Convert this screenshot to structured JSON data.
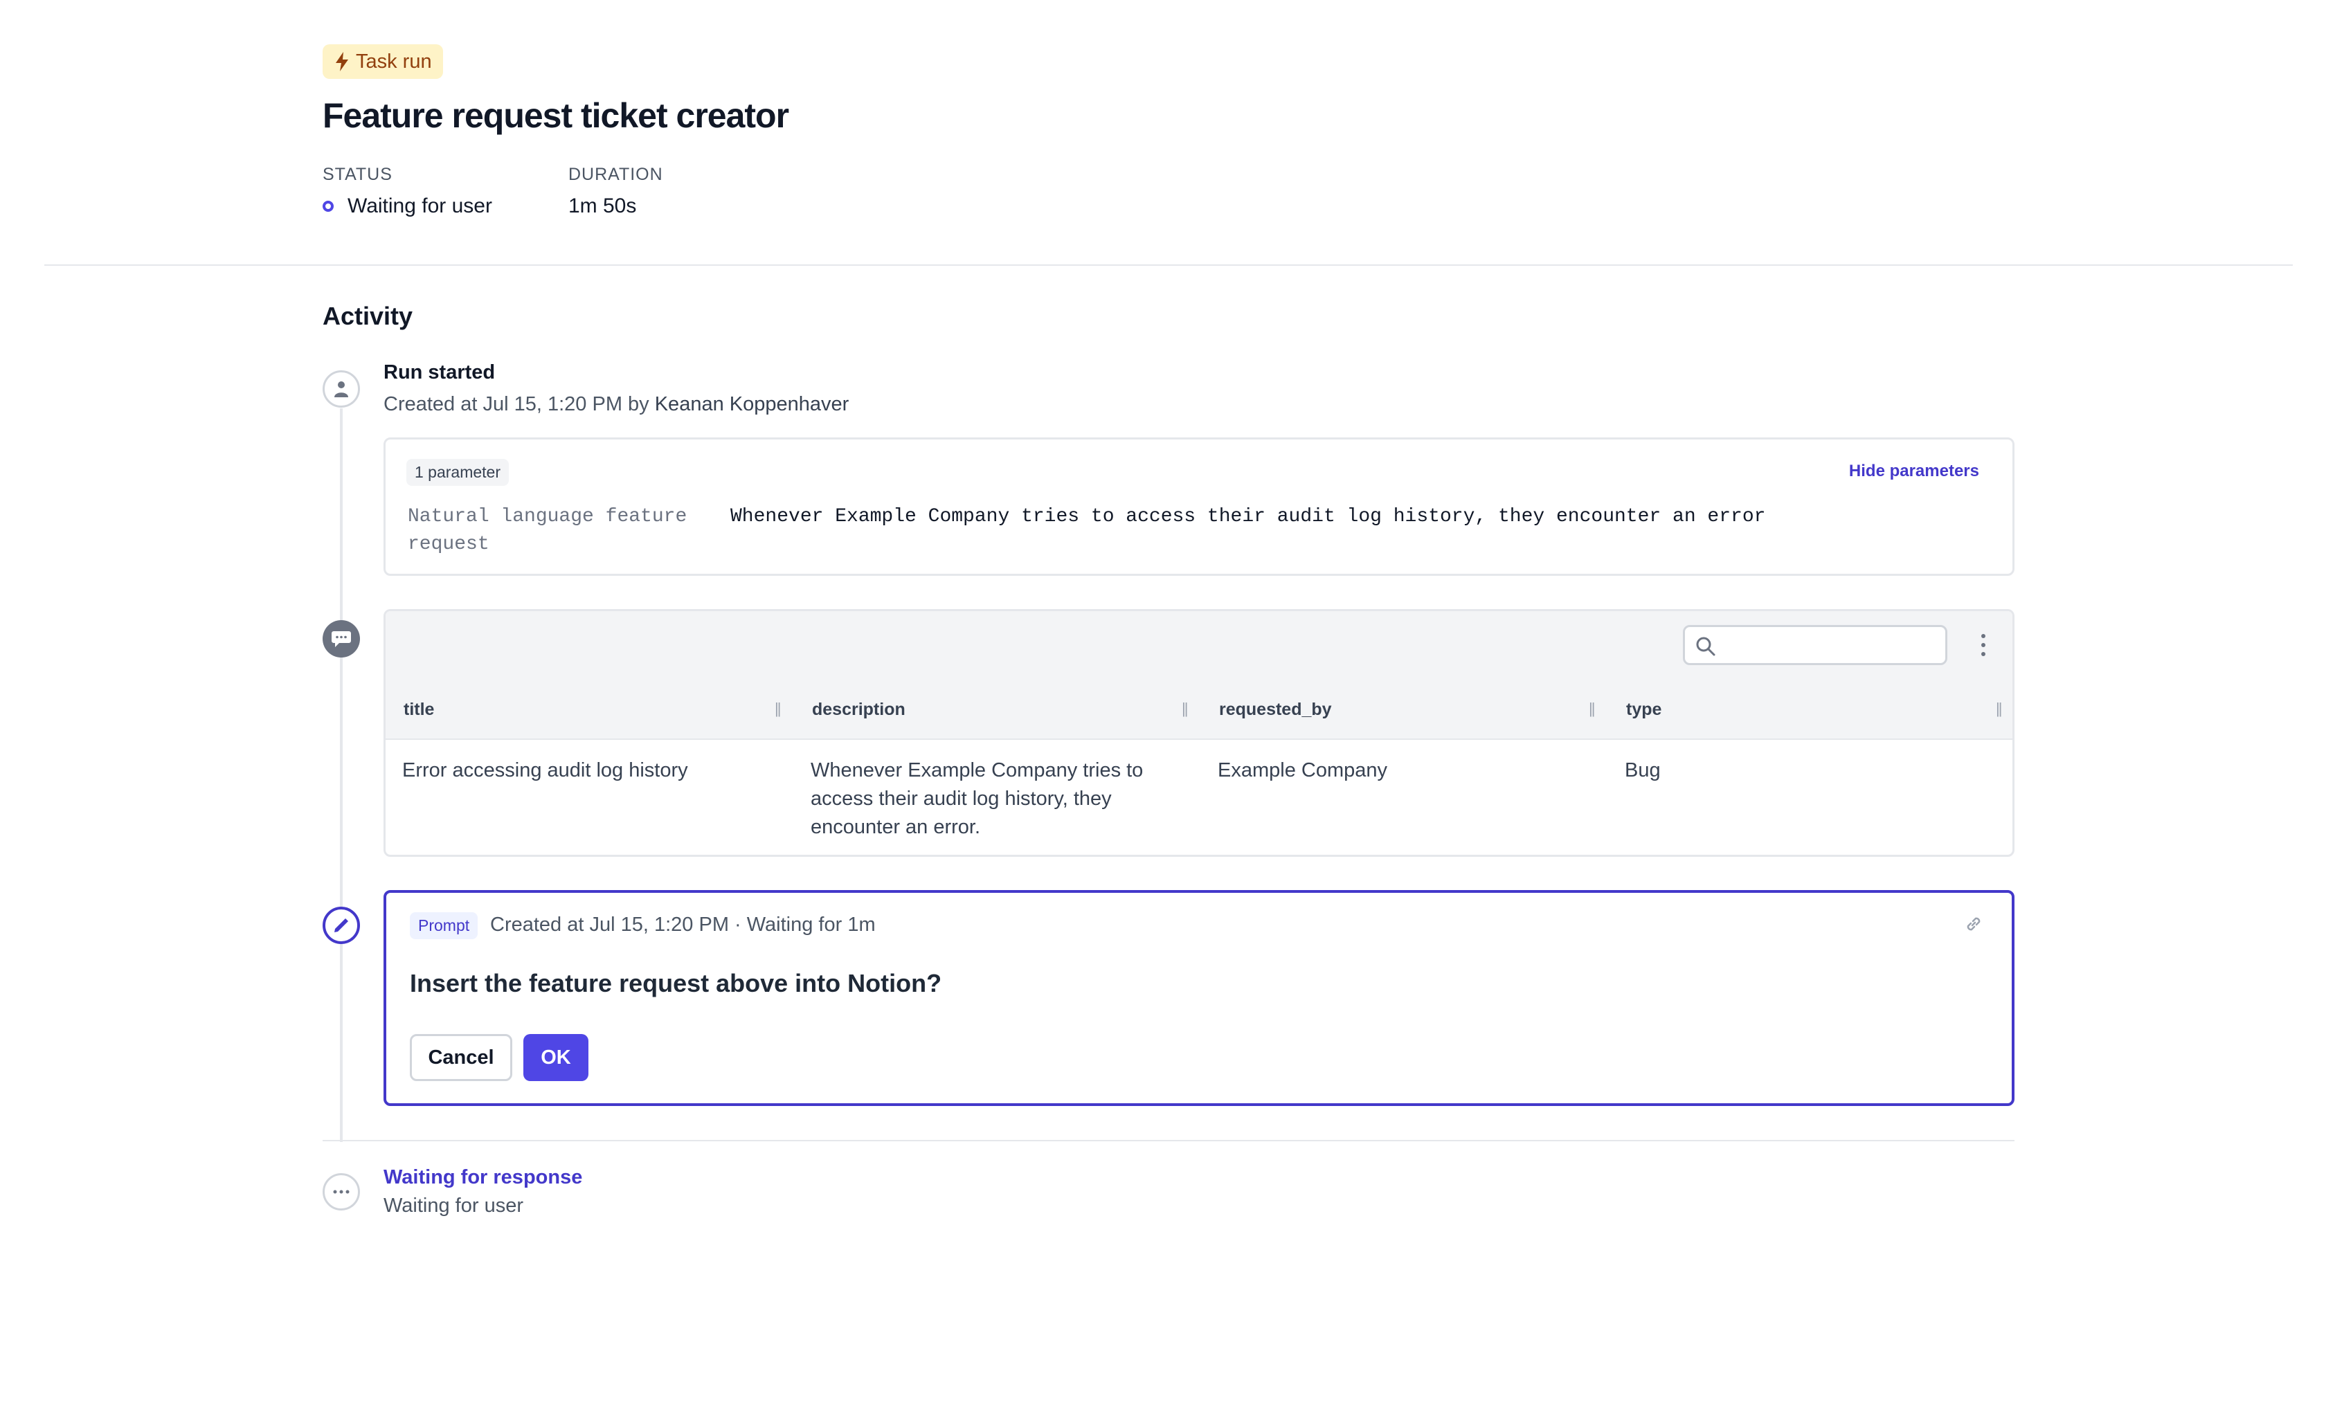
{
  "header": {
    "badge_label": "Task run",
    "title": "Feature request ticket creator",
    "status_label": "STATUS",
    "status_value": "Waiting for user",
    "duration_label": "DURATION",
    "duration_value": "1m 50s"
  },
  "activity": {
    "heading": "Activity",
    "run_started": {
      "title": "Run started",
      "subtitle_prefix": "Created at Jul 15, 1:20 PM by ",
      "user": "Keanan Koppenhaver"
    },
    "parameters": {
      "count_label": "1 parameter",
      "toggle_label": "Hide parameters",
      "items": [
        {
          "name": "Natural language feature request",
          "value": "Whenever Example Company tries to access their audit log history, they encounter an error"
        }
      ]
    },
    "table": {
      "search_placeholder": "",
      "columns": [
        "title",
        "description",
        "requested_by",
        "type"
      ],
      "rows": [
        {
          "title": "Error accessing audit log history",
          "description": "Whenever Example Company tries to access their audit log history, they encounter an error.",
          "requested_by": "Example Company",
          "type": "Bug"
        }
      ]
    },
    "prompt": {
      "chip": "Prompt",
      "meta": "Created at Jul 15, 1:20 PM · Waiting for 1m",
      "question": "Insert the feature request above into Notion?",
      "cancel_label": "Cancel",
      "ok_label": "OK"
    },
    "waiting": {
      "title": "Waiting for response",
      "subtitle": "Waiting for user"
    }
  },
  "colors": {
    "accent": "#4f46e5",
    "accent_dark": "#4338ca",
    "badge_bg": "#fef3c7",
    "badge_text": "#92400e"
  },
  "icons": [
    "bolt-icon",
    "status-ring-icon",
    "user-icon",
    "chat-icon",
    "pencil-icon",
    "ellipsis-icon",
    "search-icon",
    "kebab-icon",
    "link-icon",
    "column-grip-icon"
  ]
}
